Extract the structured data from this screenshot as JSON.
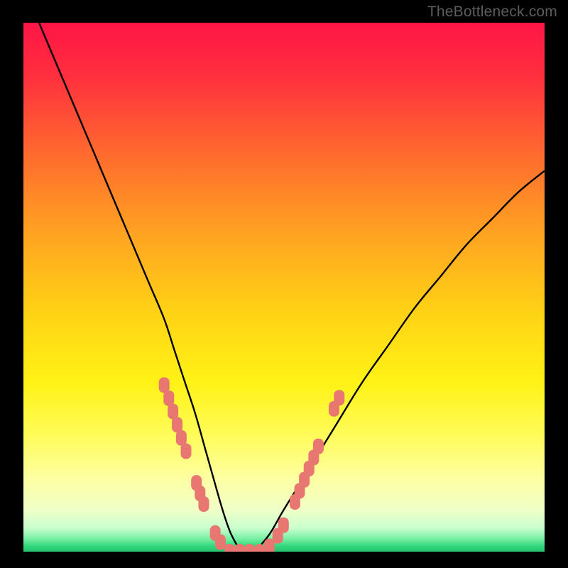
{
  "watermark": "TheBottleneck.com",
  "colors": {
    "frame": "#000000",
    "curve": "#000000",
    "marker": "#e77770",
    "bottom_band": "#2fd67a",
    "gradient_stops": [
      {
        "offset": 0.0,
        "color": "#ff1546"
      },
      {
        "offset": 0.1,
        "color": "#ff2f3e"
      },
      {
        "offset": 0.25,
        "color": "#ff6b2e"
      },
      {
        "offset": 0.4,
        "color": "#ffa321"
      },
      {
        "offset": 0.55,
        "color": "#ffd315"
      },
      {
        "offset": 0.68,
        "color": "#fff215"
      },
      {
        "offset": 0.78,
        "color": "#fffc5a"
      },
      {
        "offset": 0.86,
        "color": "#fdffa0"
      },
      {
        "offset": 0.92,
        "color": "#f1ffc8"
      },
      {
        "offset": 0.955,
        "color": "#c9ffce"
      },
      {
        "offset": 0.975,
        "color": "#7bf0a5"
      },
      {
        "offset": 0.99,
        "color": "#2fd67a"
      },
      {
        "offset": 1.0,
        "color": "#27c26d"
      }
    ]
  },
  "chart_data": {
    "type": "line",
    "title": "",
    "xlabel": "",
    "ylabel": "",
    "xlim": [
      0,
      100
    ],
    "ylim": [
      0,
      100
    ],
    "series": [
      {
        "name": "bottleneck-curve",
        "x": [
          3,
          6,
          9,
          12,
          15,
          18,
          21,
          24,
          27,
          29,
          31,
          33,
          35,
          37,
          38.5,
          40,
          42,
          44,
          47,
          50,
          55,
          60,
          65,
          70,
          75,
          80,
          85,
          90,
          95,
          100
        ],
        "y": [
          100,
          93,
          86,
          79,
          72,
          65,
          58,
          51,
          44,
          38,
          32,
          26,
          19,
          12,
          7,
          3,
          0,
          0,
          3,
          8,
          16,
          24,
          32,
          39,
          46,
          52,
          58,
          63,
          68,
          72
        ]
      }
    ],
    "markers": {
      "name": "highlighted-points",
      "color": "#e77770",
      "points": [
        {
          "x": 27.0,
          "y": 31.5
        },
        {
          "x": 27.9,
          "y": 29.0
        },
        {
          "x": 28.7,
          "y": 26.5
        },
        {
          "x": 29.5,
          "y": 24.0
        },
        {
          "x": 30.3,
          "y": 21.5
        },
        {
          "x": 31.2,
          "y": 19.0
        },
        {
          "x": 33.2,
          "y": 13.0
        },
        {
          "x": 33.9,
          "y": 11.0
        },
        {
          "x": 34.6,
          "y": 9.0
        },
        {
          "x": 36.8,
          "y": 3.5
        },
        {
          "x": 37.8,
          "y": 1.8
        },
        {
          "x": 39.6,
          "y": 0.0
        },
        {
          "x": 41.5,
          "y": 0.0
        },
        {
          "x": 43.4,
          "y": 0.0
        },
        {
          "x": 45.3,
          "y": 0.0
        },
        {
          "x": 47.2,
          "y": 1.0
        },
        {
          "x": 48.8,
          "y": 3.0
        },
        {
          "x": 49.9,
          "y": 5.0
        },
        {
          "x": 52.1,
          "y": 9.4
        },
        {
          "x": 53.0,
          "y": 11.5
        },
        {
          "x": 53.9,
          "y": 13.6
        },
        {
          "x": 54.8,
          "y": 15.7
        },
        {
          "x": 55.7,
          "y": 17.8
        },
        {
          "x": 56.6,
          "y": 19.9
        },
        {
          "x": 59.6,
          "y": 27.0
        },
        {
          "x": 60.6,
          "y": 29.1
        }
      ]
    }
  }
}
